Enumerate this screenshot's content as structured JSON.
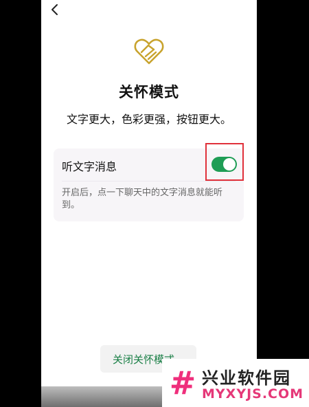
{
  "header": {
    "back_icon": "chevron-left-icon"
  },
  "hero": {
    "logo_icon": "care-hand-heart-icon",
    "title": "关怀模式",
    "subtitle": "文字更大，色彩更强，按钮更大。"
  },
  "setting": {
    "label": "听文字消息",
    "enabled": true,
    "description": "开启后，点一下聊天中的文字消息就能听到。"
  },
  "footer": {
    "close_button": "关闭关怀模式"
  },
  "watermark": {
    "title": "兴业软件园",
    "subtitle": "MYXYJS.COM"
  },
  "colors": {
    "accent_green": "#1f9d55",
    "logo_gold": "#c8a32d",
    "highlight_red": "#e0303a",
    "watermark_pink": "#ef2f7c"
  }
}
